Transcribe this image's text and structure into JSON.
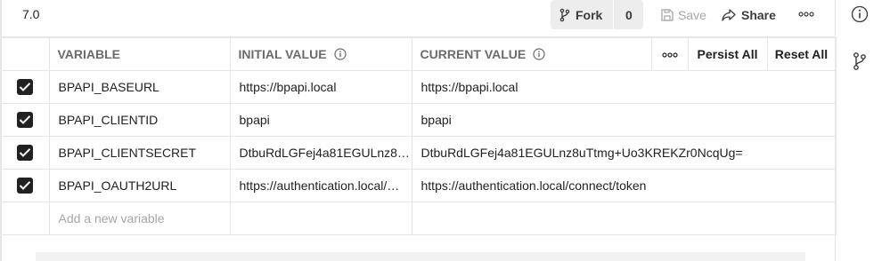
{
  "env": {
    "name": "7.0"
  },
  "toolbar": {
    "fork_label": "Fork",
    "fork_count": "0",
    "save_label": "Save",
    "share_label": "Share"
  },
  "table": {
    "headers": {
      "variable": "VARIABLE",
      "initial_value": "INITIAL VALUE",
      "current_value": "CURRENT VALUE",
      "persist_all": "Persist All",
      "reset_all": "Reset All"
    },
    "rows": [
      {
        "checked": true,
        "variable": "BPAPI_BASEURL",
        "initial": "https://bpapi.local",
        "current": "https://bpapi.local"
      },
      {
        "checked": true,
        "variable": "BPAPI_CLIENTID",
        "initial": "bpapi",
        "current": "bpapi"
      },
      {
        "checked": true,
        "variable": "BPAPI_CLIENTSECRET",
        "initial": "DtbuRdLGFej4a81EGULnz8…",
        "current": "DtbuRdLGFej4a81EGULnz8uTtmg+Uo3KREKZr0NcqUg="
      },
      {
        "checked": true,
        "variable": "BPAPI_OAUTH2URL",
        "initial": "https://authentication.local/…",
        "current": "https://authentication.local/connect/token"
      }
    ],
    "add_placeholder": "Add a new variable"
  },
  "icons": {
    "fork": "fork-icon",
    "save": "save-icon",
    "share": "share-icon",
    "more": "more-horizontal-icon",
    "info": "info-icon",
    "checkbox": "checkbox-checked-icon"
  },
  "colors": {
    "text": "#212121",
    "muted": "#6b6b6b",
    "border": "#e6e6e6",
    "checkbox": "#212121"
  }
}
